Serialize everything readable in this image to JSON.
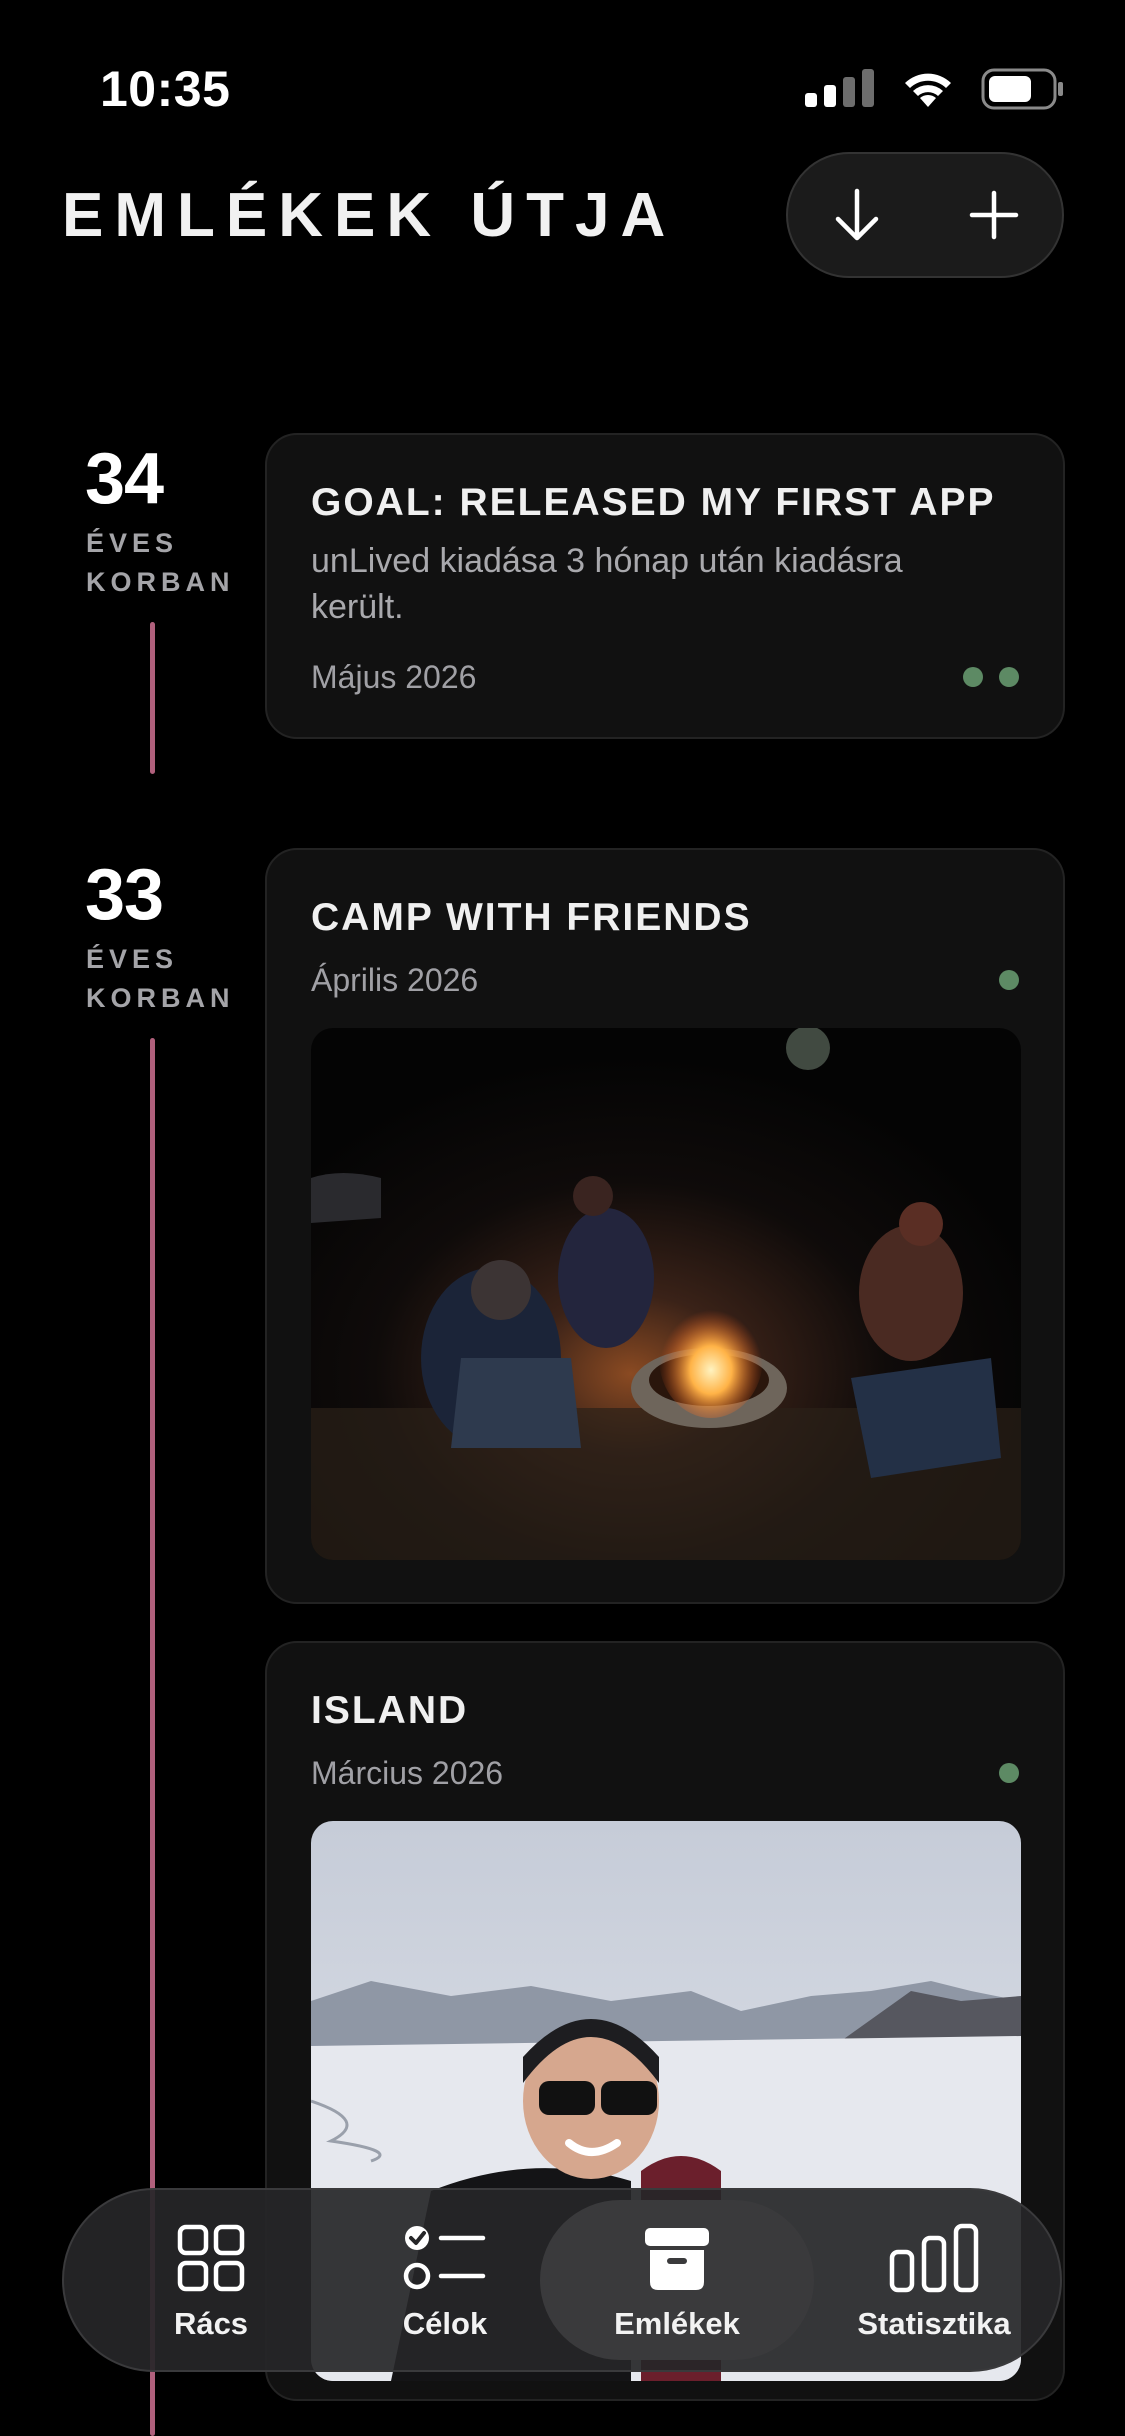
{
  "status_bar": {
    "time": "10:35"
  },
  "header": {
    "title": "EMLÉKEK ÚTJA"
  },
  "timeline": [
    {
      "age": "34",
      "age_label_line1": "ÉVES",
      "age_label_line2": "KORBAN",
      "cards": [
        {
          "title": "GOAL: RELEASED MY FIRST APP",
          "description": "unLived kiadása 3 hónap után kiadásra került.",
          "date": "Május 2026"
        }
      ]
    },
    {
      "age": "33",
      "age_label_line1": "ÉVES",
      "age_label_line2": "KORBAN",
      "cards": [
        {
          "title": "CAMP WITH FRIENDS",
          "date": "Április 2026"
        },
        {
          "title": "ISLAND",
          "date": "Március 2026"
        }
      ]
    }
  ],
  "tabbar": {
    "tabs": [
      {
        "label": "Rács",
        "icon": "grid-icon"
      },
      {
        "label": "Célok",
        "icon": "checklist-icon"
      },
      {
        "label": "Emlékek",
        "icon": "archive-box-icon",
        "active": true
      },
      {
        "label": "Statisztika",
        "icon": "bar-chart-icon"
      }
    ]
  },
  "colors": {
    "background": "#000000",
    "card": "#111111",
    "timeline_line": "#b0607c",
    "status_dot": "#5d8a64"
  }
}
